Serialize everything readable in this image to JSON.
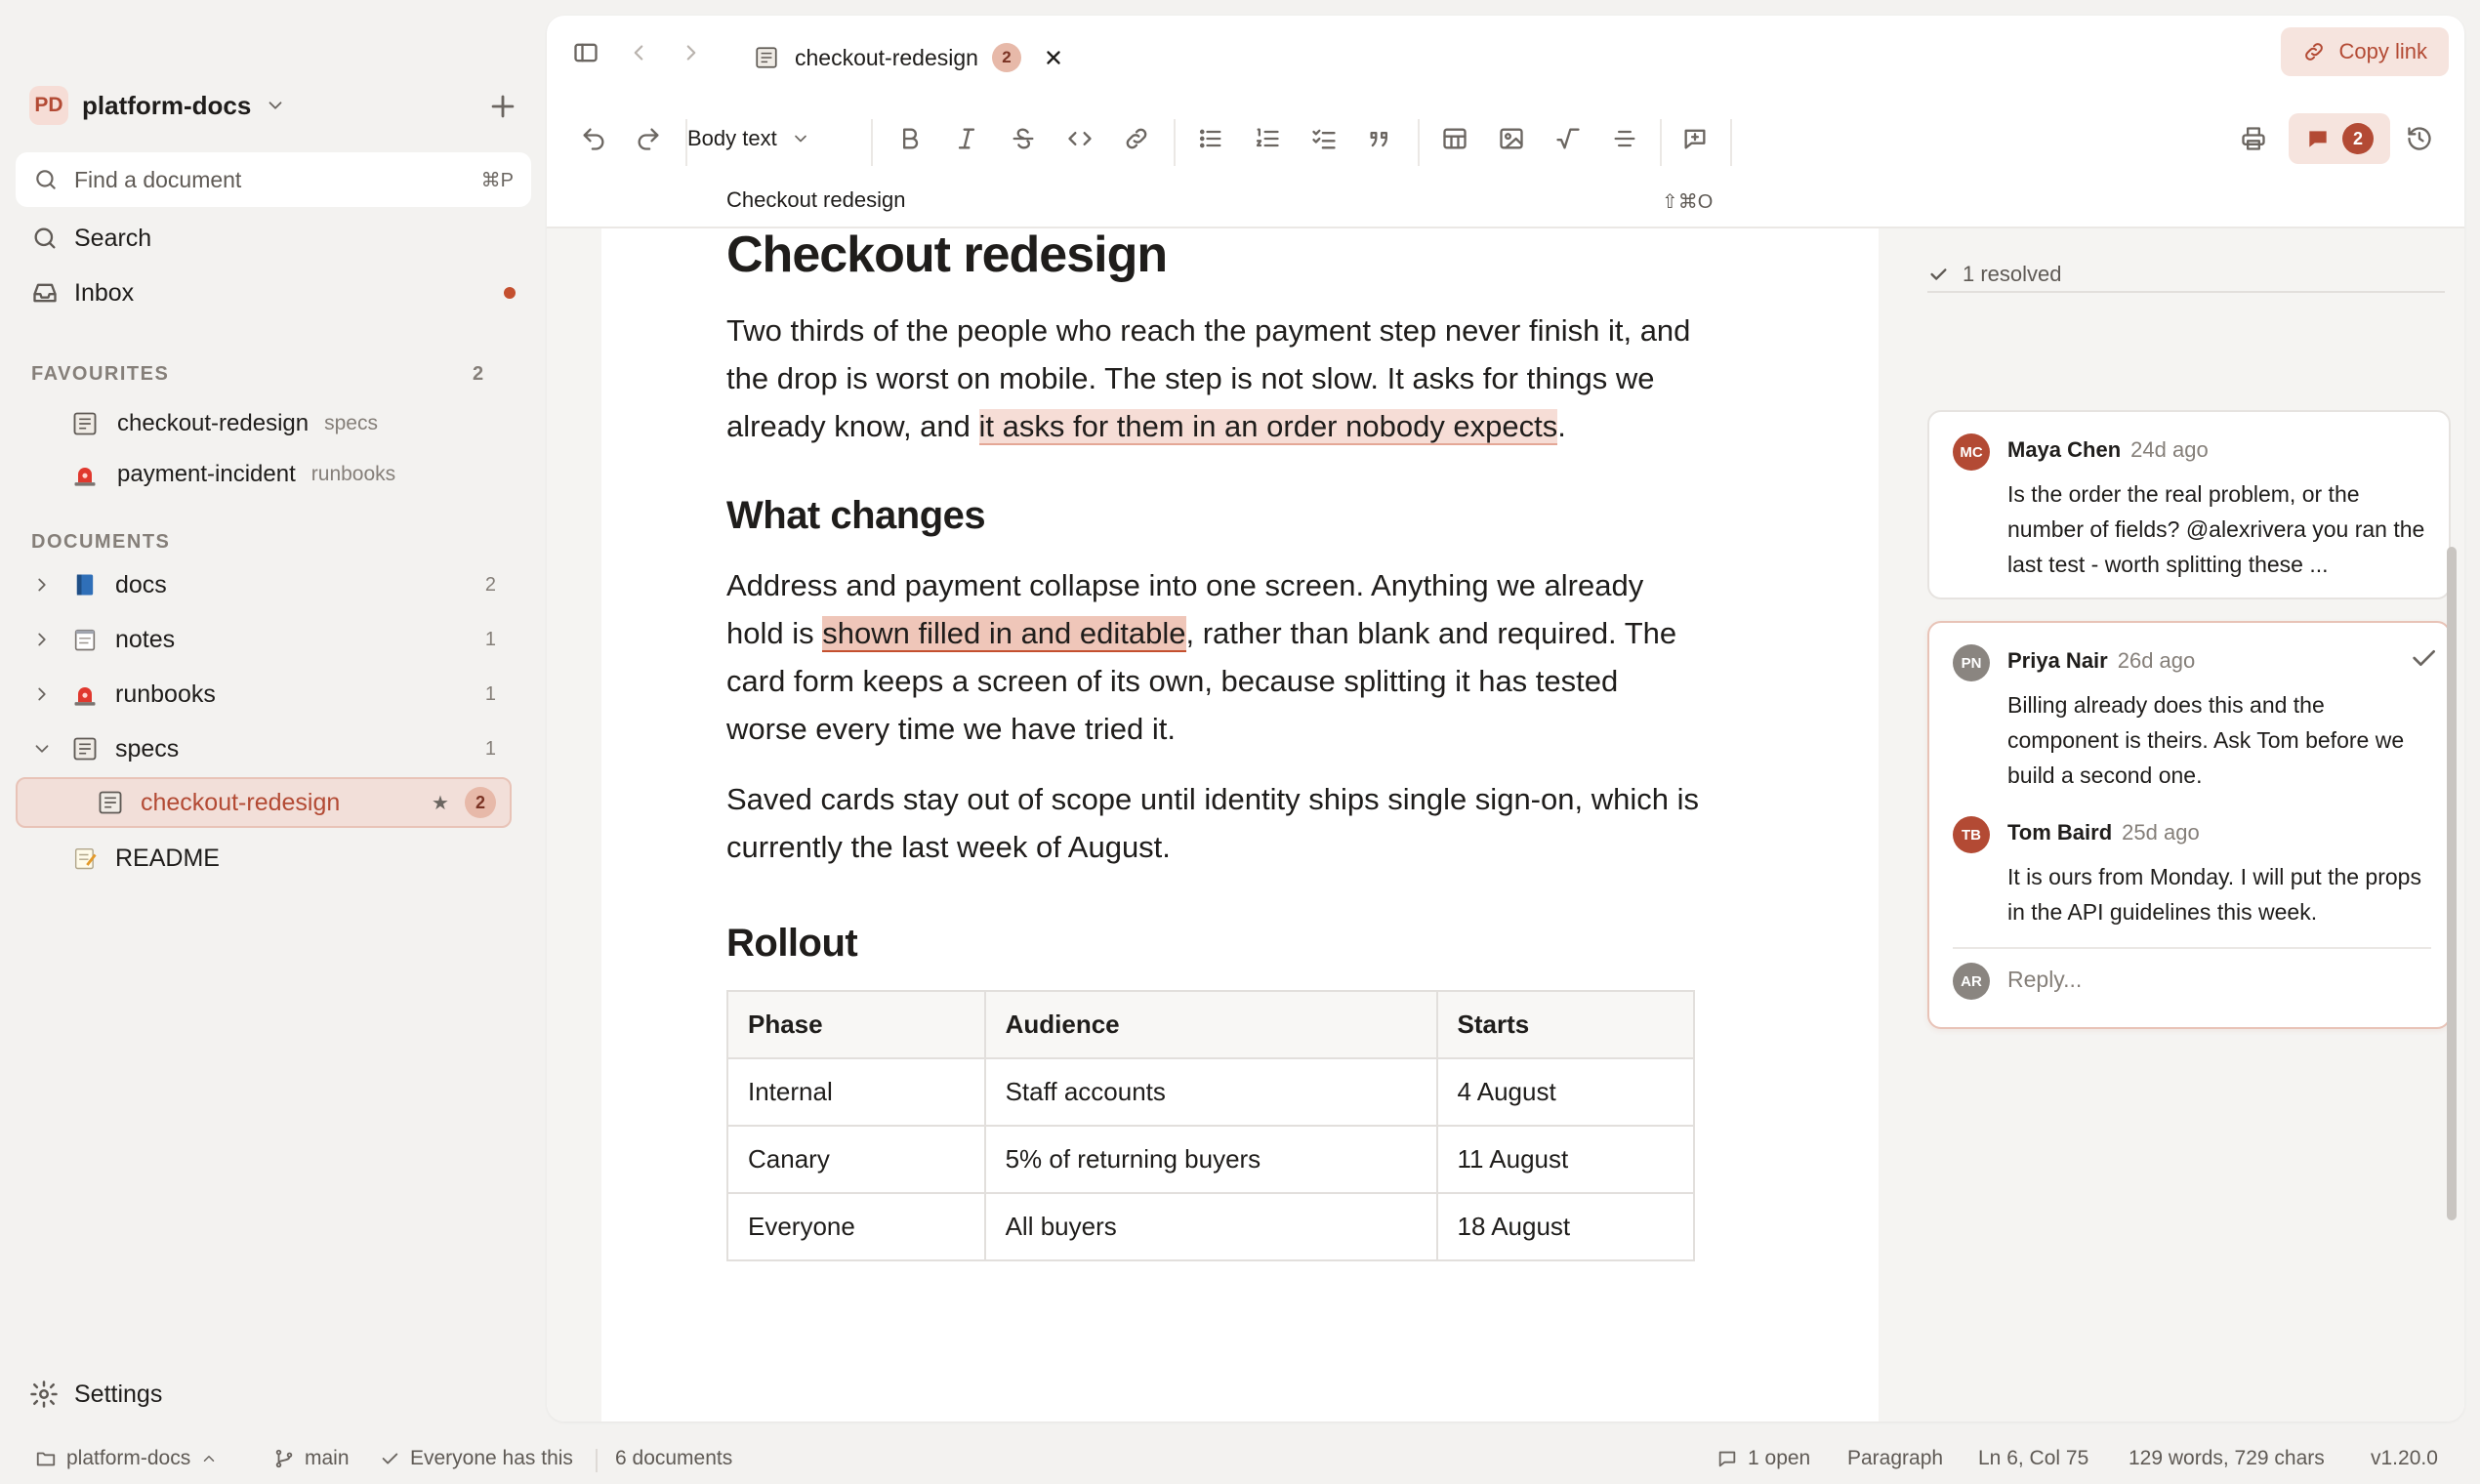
{
  "colors": {
    "accent": "#b34a34",
    "highlight": "#f6ddd6",
    "sidebar_bg": "#f3f2f0"
  },
  "sidebar": {
    "workspace": {
      "badge": "PD",
      "name": "platform-docs"
    },
    "finder": {
      "placeholder": "Find a document",
      "shortcut": "⌘P"
    },
    "search_label": "Search",
    "inbox_label": "Inbox",
    "favourites": {
      "heading": "FAVOURITES",
      "count": "2",
      "items": [
        {
          "name": "checkout-redesign",
          "folder": "specs",
          "icon": "spec-doc-icon"
        },
        {
          "name": "payment-incident",
          "folder": "runbooks",
          "icon": "siren-icon"
        }
      ]
    },
    "documents": {
      "heading": "DOCUMENTS",
      "folders": [
        {
          "name": "docs",
          "count": "2",
          "icon": "book-icon"
        },
        {
          "name": "notes",
          "count": "1",
          "icon": "notepad-icon"
        },
        {
          "name": "runbooks",
          "count": "1",
          "icon": "siren-icon"
        },
        {
          "name": "specs",
          "count": "1",
          "icon": "spec-doc-icon"
        }
      ],
      "active_doc": {
        "name": "checkout-redesign",
        "star": "★",
        "comments": "2"
      },
      "readme": "README"
    },
    "settings_label": "Settings"
  },
  "tab": {
    "name": "checkout-redesign",
    "comments": "2"
  },
  "copy_link_label": "Copy link",
  "toolbar": {
    "style_label": "Body text",
    "comment_count": "2"
  },
  "breadcrumb": {
    "title": "Checkout redesign",
    "shortcut": "⇧⌘O"
  },
  "document": {
    "title": "Checkout redesign",
    "p1": {
      "before": "Two thirds of the people who reach the payment step never finish it, and the drop is worst on mobile. The step is not slow. It asks for things we already know, and ",
      "highlight": "it asks for them in an order nobody expects",
      "after": "."
    },
    "h2_changes": "What changes",
    "p2": {
      "before": "Address and payment collapse into one screen. Anything we already hold is ",
      "highlight": "shown filled in and editable",
      "after": ", rather than blank and required. The card form keeps a screen of its own, because splitting it has tested worse every time we have tried it."
    },
    "p3": "Saved cards stay out of scope until identity ships single sign-on, which is currently the last week of August.",
    "h2_rollout": "Rollout",
    "table": {
      "headers": [
        "Phase",
        "Audience",
        "Starts"
      ],
      "rows": [
        [
          "Internal",
          "Staff accounts",
          "4 August"
        ],
        [
          "Canary",
          "5% of returning buyers",
          "11 August"
        ],
        [
          "Everyone",
          "All buyers",
          "18 August"
        ]
      ]
    }
  },
  "comments": {
    "resolved_label": "1 resolved",
    "thread1": {
      "initials": "MC",
      "author": "Maya Chen",
      "when": "24d ago",
      "text": "Is the order the real problem, or the number of fields? @alexrivera you ran the last test - worth splitting these ...",
      "avatar_color": "#b34a34"
    },
    "thread2": {
      "c1": {
        "initials": "PN",
        "author": "Priya Nair",
        "when": "26d ago",
        "text": "Billing already does this and the component is theirs. Ask Tom before we build a second one.",
        "avatar_color": "#8a8580"
      },
      "c2": {
        "initials": "TB",
        "author": "Tom Baird",
        "when": "25d ago",
        "text": "It is ours from Monday. I will put the props in the API guidelines this week.",
        "avatar_color": "#b34a34"
      },
      "reply_initials": "AR",
      "reply_placeholder": "Reply..."
    }
  },
  "statusbar": {
    "workspace": "platform-docs",
    "branch": "main",
    "sharing": "Everyone has this",
    "doc_count": "6 documents",
    "open_comments": "1 open",
    "block_type": "Paragraph",
    "cursor": "Ln 6, Col 75",
    "counts": "129 words, 729 chars",
    "version": "v1.20.0"
  }
}
